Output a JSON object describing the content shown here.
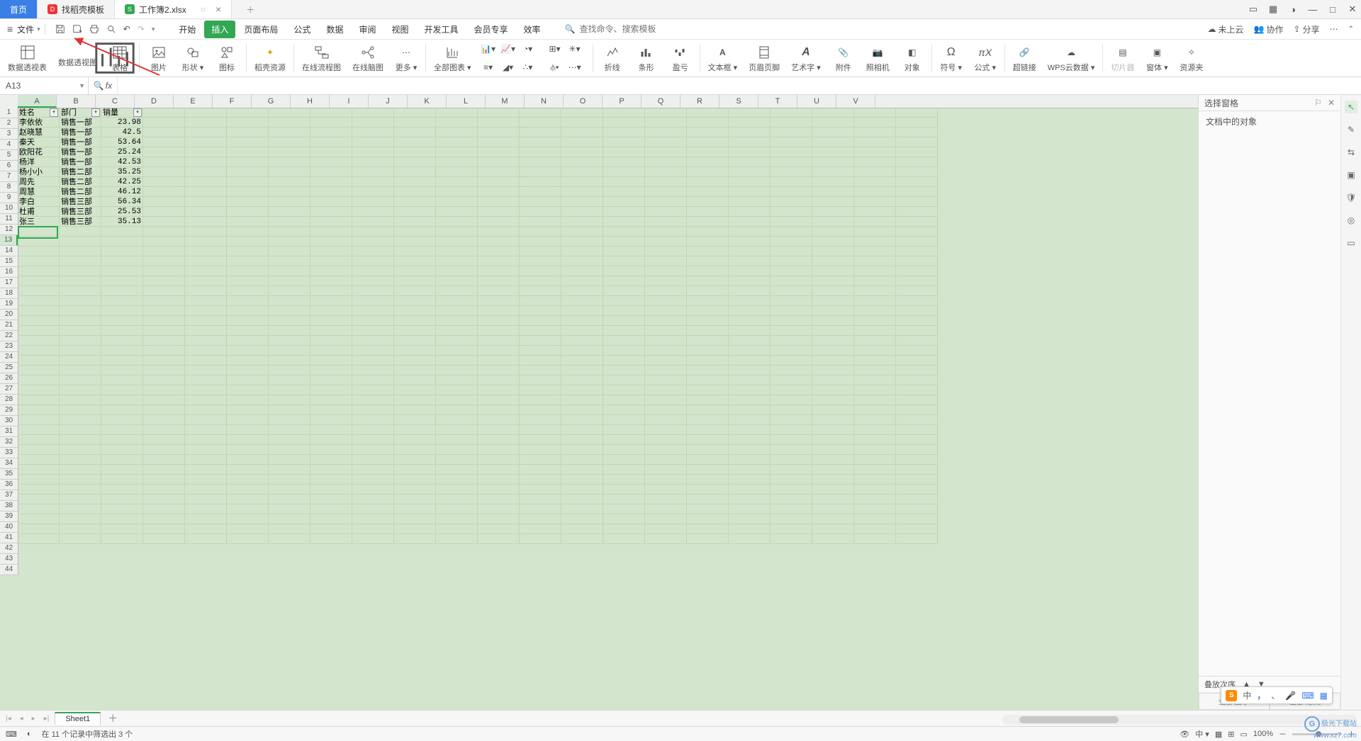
{
  "tabs": {
    "home": "首页",
    "template": "找稻壳模板",
    "file": "工作簿2.xlsx"
  },
  "menubar": {
    "file": "文件"
  },
  "mainmenu": {
    "items": [
      "开始",
      "插入",
      "页面布局",
      "公式",
      "数据",
      "审阅",
      "视图",
      "开发工具",
      "会员专享",
      "效率"
    ],
    "activeIndex": 1
  },
  "search": {
    "placeholder": "查找命令、搜索模板",
    "prefix": "Q"
  },
  "cloud": {
    "notuploaded": "未上云",
    "coop": "协作",
    "share": "分享"
  },
  "ribbon": {
    "pivotTable": "数据透视表",
    "pivotChart": "数据透视图",
    "table": "表格",
    "picture": "图片",
    "shapes": "形状",
    "icons": "图标",
    "daoke": "稻壳资源",
    "onlineFlow": "在线流程图",
    "onlineMind": "在线脑图",
    "more": "更多",
    "allCharts": "全部图表",
    "line": "折线",
    "bar": "条形",
    "winloss": "盈亏",
    "textbox": "文本框",
    "header": "页眉页脚",
    "wordart": "艺术字",
    "attach": "附件",
    "camera": "照相机",
    "object": "对象",
    "symbol": "符号",
    "equation": "公式",
    "hyperlink": "超链接",
    "wpscloud": "WPS云数据",
    "slicer": "切片器",
    "form": "窗体",
    "resource": "资源夹"
  },
  "namebox": "A13",
  "fx": "fx",
  "columns": [
    "A",
    "B",
    "C",
    "D",
    "E",
    "F",
    "G",
    "H",
    "I",
    "J",
    "K",
    "L",
    "M",
    "N",
    "O",
    "P",
    "Q",
    "R",
    "S",
    "T",
    "U",
    "V"
  ],
  "headers": {
    "name": "姓名",
    "dept": "部门",
    "sales": "销量"
  },
  "rows": [
    {
      "n": "李依依",
      "d": "销售一部",
      "v": "23.98"
    },
    {
      "n": "赵晓慧",
      "d": "销售一部",
      "v": "42.5"
    },
    {
      "n": "秦天",
      "d": "销售一部",
      "v": "53.64"
    },
    {
      "n": "欧阳花",
      "d": "销售一部",
      "v": "25.24"
    },
    {
      "n": "杨洋",
      "d": "销售一部",
      "v": "42.53"
    },
    {
      "n": "杨小小",
      "d": "销售二部",
      "v": "35.25"
    },
    {
      "n": "周先",
      "d": "销售二部",
      "v": "42.25"
    },
    {
      "n": "周慧",
      "d": "销售二部",
      "v": "46.12"
    },
    {
      "n": "李白",
      "d": "销售三部",
      "v": "56.34"
    },
    {
      "n": "杜甫",
      "d": "销售三部",
      "v": "25.53"
    },
    {
      "n": "张三",
      "d": "销售三部",
      "v": "35.13"
    }
  ],
  "visibleRows": 44,
  "side": {
    "title": "选择窗格",
    "sub": "文档中的对象",
    "stack": "叠放次序",
    "showAll": "全部显示",
    "hideAll": "全部隐藏"
  },
  "sheet": {
    "name": "Sheet1"
  },
  "status": {
    "msg": "在 11 个记录中筛选出 3 个",
    "zoom": "100%"
  },
  "ime": {
    "lang": "中",
    "punct": "，",
    "sep": "、"
  },
  "wm": {
    "l1": "极光下载站",
    "l2": "www.xz7.com"
  }
}
